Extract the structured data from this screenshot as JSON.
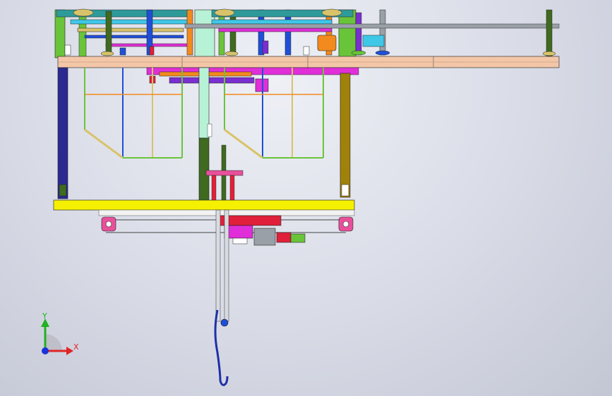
{
  "triad": {
    "y_label": "Y",
    "x_label": "X",
    "y_color": "#21b021",
    "x_color": "#e02424",
    "origin_color": "#1a32d8"
  },
  "colors": {
    "top_beam": "#f3c6a8",
    "bottom_beam": "#f5f000",
    "left_column": "#2a2a90",
    "right_column": "#a0820a",
    "frame_green": "#6ac43a",
    "frame_blue": "#1f4fd8",
    "frame_cyan": "#3fc7e8",
    "magenta": "#e02fd8",
    "orange": "#f28a1e",
    "red": "#e0203a",
    "shaft_grey": "#9aa0a8",
    "rod_olive": "#3f6a20",
    "mint": "#b8f2d6",
    "violet": "#7a2fd0",
    "tan": "#d8c36a",
    "pink": "#e8509a",
    "teal": "#2f9a9a"
  }
}
